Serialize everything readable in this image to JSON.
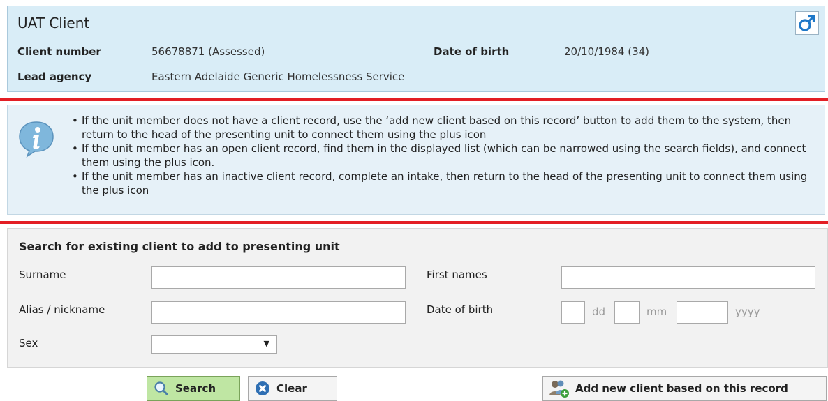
{
  "client": {
    "title": "UAT Client",
    "client_number_label": "Client number",
    "client_number_value": "56678871 (Assessed)",
    "dob_label": "Date of birth",
    "dob_value": "20/10/1984 (34)",
    "lead_agency_label": "Lead agency",
    "lead_agency_value": "Eastern Adelaide Generic Homelessness Service",
    "gender_icon": "male-symbol-icon"
  },
  "info": {
    "icon": "info-icon",
    "lines": [
      "If the unit member does not have a client record, use the ‘add new client based on this record’ button to add them to the system, then return to the head of the presenting unit to connect them using the plus icon",
      "If the unit member has an open client record, find them in the displayed list (which can be narrowed using the search fields), and connect them using the plus icon.",
      "If the unit member has an inactive client record, complete an intake, then return to the head of the presenting unit to connect them using the plus icon"
    ]
  },
  "search": {
    "heading": "Search for existing client to add to presenting unit",
    "surname_label": "Surname",
    "surname_value": "",
    "first_names_label": "First names",
    "first_names_value": "",
    "alias_label": "Alias / nickname",
    "alias_value": "",
    "dob_label": "Date of birth",
    "dob_day_hint": "dd",
    "dob_month_hint": "mm",
    "dob_year_hint": "yyyy",
    "sex_label": "Sex",
    "sex_selected": ""
  },
  "buttons": {
    "search_label": "Search",
    "clear_label": "Clear",
    "add_new_label": "Add new client based on this record"
  },
  "colors": {
    "accent_red": "#e31e24",
    "client_panel_bg": "#d9edf7",
    "search_button_bg": "#bfe6a3",
    "gender_icon": "#1f78c8"
  }
}
